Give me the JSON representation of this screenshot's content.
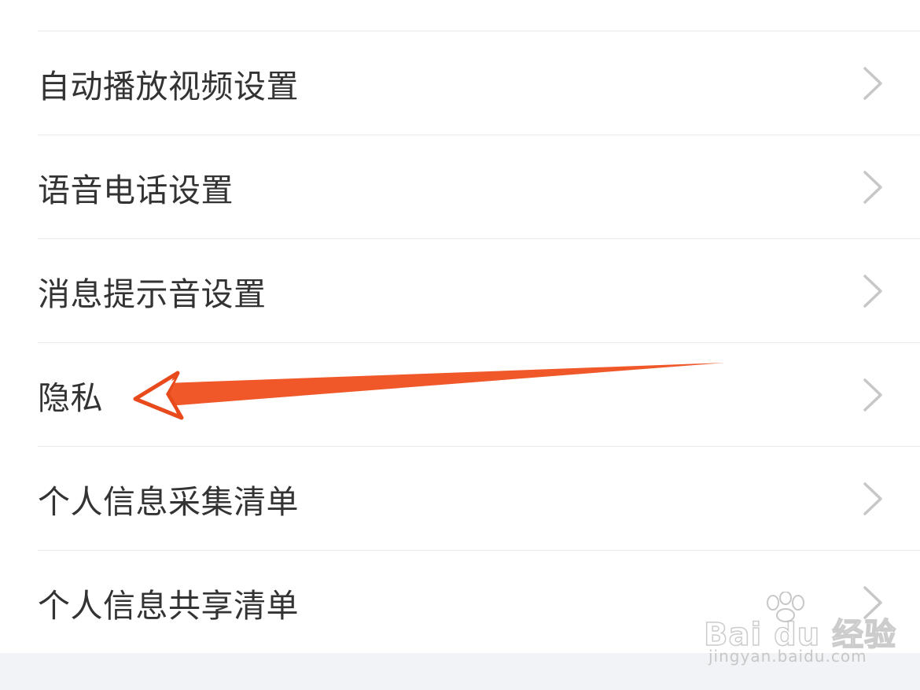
{
  "settings": {
    "items": [
      {
        "label": "自动播放视频设置",
        "icon": "chevron-right-icon"
      },
      {
        "label": "语音电话设置",
        "icon": "chevron-right-icon"
      },
      {
        "label": "消息提示音设置",
        "icon": "chevron-right-icon"
      },
      {
        "label": "隐私",
        "icon": "chevron-right-icon"
      },
      {
        "label": "个人信息采集清单",
        "icon": "chevron-right-icon"
      },
      {
        "label": "个人信息共享清单",
        "icon": "chevron-right-icon"
      }
    ]
  },
  "annotation": {
    "arrow_color": "#f0582a",
    "arrow_outline": "#e94a1c",
    "points_to": "隐私"
  },
  "watermark": {
    "logo": "Bai du 经验",
    "url": "jingyan.baidu.com"
  },
  "colors": {
    "label_text": "#333333",
    "divider": "#e9e9e9",
    "chevron": "#c7c7c7",
    "footer_band": "#f2f3f6"
  }
}
